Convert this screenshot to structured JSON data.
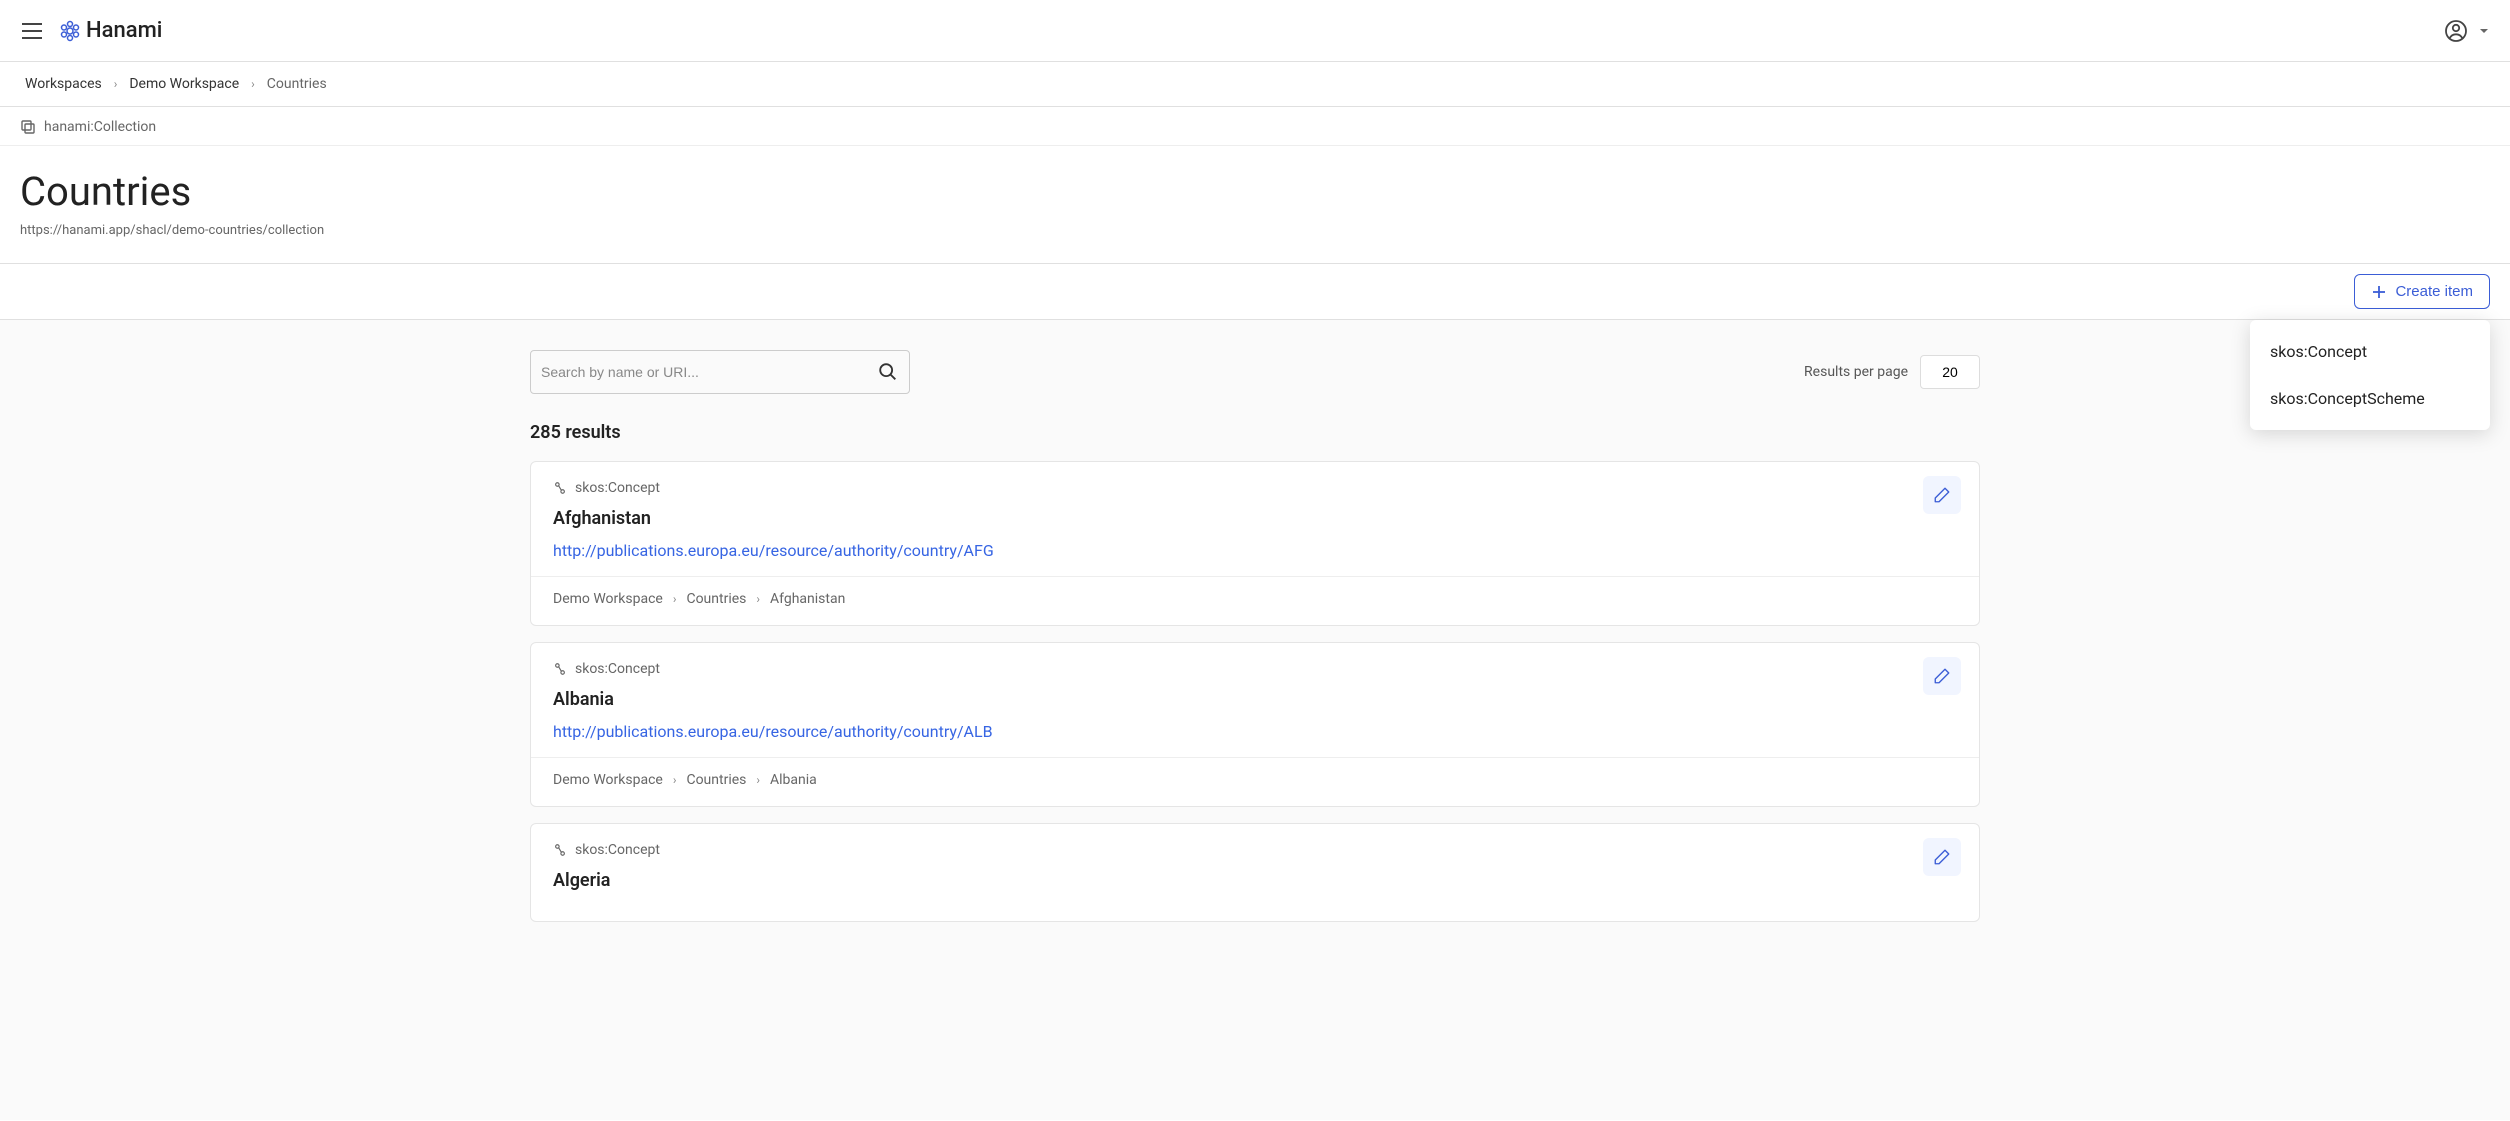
{
  "brand": {
    "name": "Hanami"
  },
  "breadcrumb": {
    "items": [
      "Workspaces",
      "Demo Workspace",
      "Countries"
    ]
  },
  "header": {
    "collection_type": "hanami:Collection",
    "title": "Countries",
    "uri": "https://hanami.app/shacl/demo-countries/collection"
  },
  "toolbar": {
    "create_label": "Create item",
    "dropdown": [
      "skos:Concept",
      "skos:ConceptScheme"
    ]
  },
  "search": {
    "placeholder": "Search by name or URI..."
  },
  "pager": {
    "label": "Results per page",
    "value": "20"
  },
  "results": {
    "count_text": "285 results",
    "items": [
      {
        "type": "skos:Concept",
        "name": "Afghanistan",
        "uri": "http://publications.europa.eu/resource/authority/country/AFG",
        "crumb": [
          "Demo Workspace",
          "Countries",
          "Afghanistan"
        ]
      },
      {
        "type": "skos:Concept",
        "name": "Albania",
        "uri": "http://publications.europa.eu/resource/authority/country/ALB",
        "crumb": [
          "Demo Workspace",
          "Countries",
          "Albania"
        ]
      },
      {
        "type": "skos:Concept",
        "name": "Algeria",
        "uri": "",
        "crumb": []
      }
    ]
  }
}
